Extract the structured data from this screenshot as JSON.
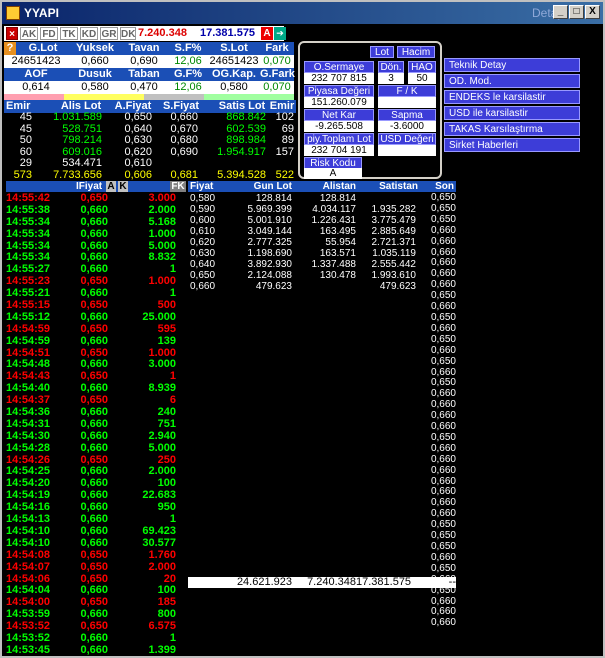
{
  "window": {
    "title": "YYAPI",
    "detay": "Detay",
    "min_icon": "_",
    "max_icon": "□",
    "close_icon": "X"
  },
  "toolbar": {
    "items": [
      "AK",
      "FD",
      "TK",
      "KD",
      "GR",
      "DK"
    ],
    "last_price": "7.240.348",
    "index_value": "17.381.575",
    "a_label": "A"
  },
  "stats": {
    "row1_headers": [
      "G.Lot",
      "Yuksek",
      "Tavan",
      "S.F%",
      "S.Lot",
      "Fark"
    ],
    "row1_values": [
      "24651423",
      "0,660",
      "0,690",
      "12,06",
      "24651423",
      "0,070"
    ],
    "row2_headers": [
      "AOF",
      "Dusuk",
      "Taban",
      "G.F%",
      "OG.Kap.",
      "G.Fark"
    ],
    "row2_values": [
      "0,614",
      "0,580",
      "0,470",
      "12,06",
      "0,580",
      "0,070"
    ]
  },
  "depth": {
    "headers": [
      "Emir",
      "Alis Lot",
      "A.Fiyat",
      "S.Fiyat",
      "Satis Lot",
      "Emir"
    ],
    "rows": [
      [
        "45",
        "1.031.589",
        "0,650",
        "0,660",
        "868.842",
        "102"
      ],
      [
        "45",
        "528.751",
        "0,640",
        "0,670",
        "602.539",
        "69"
      ],
      [
        "50",
        "798.214",
        "0,630",
        "0,680",
        "898.984",
        "89"
      ],
      [
        "60",
        "609.016",
        "0,620",
        "0,690",
        "1.954.917",
        "157"
      ],
      [
        "29",
        "534.471",
        "0,610",
        "",
        "",
        ""
      ]
    ],
    "total": [
      "573",
      "7.733.656",
      "0,606",
      "0,681",
      "5.394.528",
      "522"
    ]
  },
  "panel": {
    "lot_label": "Lot",
    "hacim_label": "Hacim",
    "osermaye_label": "O.Sermaye",
    "osermaye_value": "232 707 815",
    "don_label": "Dön.",
    "don_value": "3",
    "hao_label": "HAO",
    "hao_value": "50",
    "piyasa_label": "Piyasa Değeri",
    "piyasa_value": "151.260.079",
    "fk_label": "F / K",
    "netkar_label": "Net Kar",
    "netkar_value": "-9.265.508",
    "sapma_label": "Sapma",
    "sapma_value": "-3.6000",
    "toplam_label": "piy.Toplam Lot",
    "toplam_value": "232 704 191",
    "usd_label": "USD Değeri",
    "risk_label": "Risk Kodu",
    "risk_value": "A"
  },
  "right_menu": [
    "Teknik Detay",
    "OD. Mod.",
    "ENDEKS le karsilastir",
    "USD ile karsilastir",
    "TAKAS Karsılaştırma",
    "Sirket Haberleri"
  ],
  "trades_header": {
    "fiyat": "IFiyat",
    "a": "A",
    "k": "K",
    "fk": "FK"
  },
  "trades": [
    [
      "14:55:42",
      "0,650",
      "3.000",
      "dn"
    ],
    [
      "14:55:38",
      "0,660",
      "2.000",
      "up"
    ],
    [
      "14:55:34",
      "0,660",
      "5.168",
      "up"
    ],
    [
      "14:55:34",
      "0,660",
      "1.000",
      "up"
    ],
    [
      "14:55:34",
      "0,660",
      "5.000",
      "up"
    ],
    [
      "14:55:34",
      "0,660",
      "8.832",
      "up"
    ],
    [
      "14:55:27",
      "0,660",
      "1",
      "up"
    ],
    [
      "14:55:23",
      "0,650",
      "1.000",
      "dn"
    ],
    [
      "14:55:21",
      "0,660",
      "1",
      "up"
    ],
    [
      "14:55:15",
      "0,650",
      "500",
      "dn"
    ],
    [
      "14:55:12",
      "0,660",
      "25.000",
      "up"
    ],
    [
      "14:54:59",
      "0,650",
      "595",
      "dn"
    ],
    [
      "14:54:59",
      "0,660",
      "139",
      "up"
    ],
    [
      "14:54:51",
      "0,650",
      "1.000",
      "dn"
    ],
    [
      "14:54:48",
      "0,660",
      "3.000",
      "up"
    ],
    [
      "14:54:43",
      "0,650",
      "1",
      "dn"
    ],
    [
      "14:54:40",
      "0,660",
      "8.939",
      "up"
    ],
    [
      "14:54:37",
      "0,650",
      "6",
      "dn"
    ],
    [
      "14:54:36",
      "0,660",
      "240",
      "up"
    ],
    [
      "14:54:31",
      "0,660",
      "751",
      "up"
    ],
    [
      "14:54:30",
      "0,660",
      "2.940",
      "up"
    ],
    [
      "14:54:28",
      "0,660",
      "5.000",
      "up"
    ],
    [
      "14:54:26",
      "0,650",
      "250",
      "dn"
    ],
    [
      "14:54:25",
      "0,660",
      "2.000",
      "up"
    ],
    [
      "14:54:20",
      "0,660",
      "100",
      "up"
    ],
    [
      "14:54:19",
      "0,660",
      "22.683",
      "up"
    ],
    [
      "14:54:16",
      "0,660",
      "950",
      "up"
    ],
    [
      "14:54:13",
      "0,660",
      "1",
      "up"
    ],
    [
      "14:54:10",
      "0,660",
      "69.423",
      "up"
    ],
    [
      "14:54:10",
      "0,660",
      "30.577",
      "up"
    ],
    [
      "14:54:08",
      "0,650",
      "1.760",
      "dn"
    ],
    [
      "14:54:07",
      "0,650",
      "2.000",
      "dn"
    ],
    [
      "14:54:06",
      "0,650",
      "20",
      "dn"
    ],
    [
      "14:54:04",
      "0,660",
      "100",
      "up"
    ],
    [
      "14:54:00",
      "0,650",
      "185",
      "dn"
    ],
    [
      "14:53:59",
      "0,660",
      "800",
      "up"
    ],
    [
      "14:53:52",
      "0,650",
      "6.575",
      "dn"
    ],
    [
      "14:53:52",
      "0,660",
      "1",
      "up"
    ],
    [
      "14:53:45",
      "0,660",
      "1.399",
      "up"
    ]
  ],
  "price_table": {
    "headers": [
      "Fiyat",
      "Gun Lot",
      "Alistan",
      "Satistan",
      "Son"
    ],
    "rows": [
      [
        "0,580",
        "128.814",
        "128.814",
        ""
      ],
      [
        "0,590",
        "5.969.399",
        "4.034.117",
        "1.935.282"
      ],
      [
        "0,600",
        "5.001.910",
        "1.226.431",
        "3.775.479"
      ],
      [
        "0,610",
        "3.049.144",
        "163.495",
        "2.885.649"
      ],
      [
        "0,620",
        "2.777.325",
        "55.954",
        "2.721.371"
      ],
      [
        "0,630",
        "1.198.690",
        "163.571",
        "1.035.119"
      ],
      [
        "0,640",
        "3.892.930",
        "1.337.488",
        "2.555.442"
      ],
      [
        "0,650",
        "2.124.088",
        "130.478",
        "1.993.610"
      ],
      [
        "0,660",
        "479.623",
        "",
        "479.623"
      ]
    ],
    "son": [
      "0,650",
      "0,650",
      "0,650",
      "0,660",
      "0,660",
      "0,660",
      "0,660",
      "0,660",
      "0,660",
      "0,650",
      "0,660",
      "0,650",
      "0,660",
      "0,650",
      "0,660",
      "0,650",
      "0,660",
      "0,650",
      "0,660",
      "0,660",
      "0,660",
      "0,660",
      "0,650",
      "0,660",
      "0,660",
      "0,660",
      "0,660",
      "0,660",
      "0,660",
      "0,660",
      "0,650",
      "0,650",
      "0,650",
      "0,660",
      "0,650",
      "0,660",
      "0,650",
      "0,660",
      "0,660",
      "0,660"
    ],
    "totals": [
      "24.621.923",
      "7.240.348",
      "17.381.575",
      "--"
    ]
  }
}
